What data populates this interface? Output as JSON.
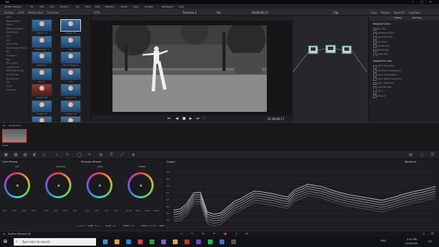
{
  "window": {
    "title": "Sol"
  },
  "menu": [
    "DaVinci Resolve",
    "File",
    "Edit",
    "Trim",
    "Timeline",
    "Clip",
    "Mark",
    "View",
    "Playback",
    "Fusion",
    "Color",
    "Fairlight",
    "Workspace",
    "Help"
  ],
  "toolbar": {
    "left": [
      "Gallery",
      "LUTs",
      "Media Pool",
      "Timeline"
    ],
    "zoom": "47%",
    "timeline_name": "Timeline 1",
    "project": "Sol",
    "timecode": "00:00:00:17",
    "clip_label": "Clip",
    "right": [
      "Clips",
      "Nodes",
      "OpenFX",
      "Lightbox"
    ]
  },
  "albums": [
    "Stills",
    "PowerGrade",
    "Stills 2",
    "MemoryUsage 1",
    "ShotMatch",
    "MC",
    "LUT",
    "Sony SLog",
    "Blackmagic Design",
    "DJI",
    "Panasonic",
    "Red",
    "Film Looks",
    "LinearInvert",
    "HDR Hybrid Log",
    "VSO/RC Rec",
    "Technicolor",
    "Fuji",
    "ACES",
    "Favorites"
  ],
  "stills": [
    {
      "a": "Custom 11",
      "b": "Custom 12",
      "ar": false,
      "br": false
    },
    {
      "a": "Blackmagic 7",
      "b": "Clip",
      "ar": false,
      "br": false
    },
    {
      "a": "Aged Film",
      "b": "Bleach Bypass",
      "ar": false,
      "br": false
    },
    {
      "a": "Blue 2",
      "b": "Cool",
      "ar": false,
      "br": false
    },
    {
      "a": "Clayton 18",
      "b": "Custom 11",
      "ar": true,
      "br": false
    },
    {
      "a": "Custom 21",
      "b": "Custom 15",
      "ar": false,
      "br": false
    },
    {
      "a": "Digital 1",
      "b": "Custom 20",
      "ar": false,
      "br": false
    },
    {
      "a": "Custom 11",
      "b": "Custom 2",
      "ar": false,
      "br": false
    }
  ],
  "viewer": {
    "timecode_out": "01:00:00:17"
  },
  "library": {
    "tabs": [
      "Library",
      "Settings"
    ],
    "section1": "ResolveFX Blur",
    "blur": [
      "Box Blur",
      "Directional Blur",
      "Gaussian Blur",
      "Lens Blur",
      "Mosaic Blur",
      "Radial Blur",
      "Zoom Blur"
    ],
    "section2": "ResolveFX Color",
    "color": [
      "ACES Transform",
      "Chromatic Adaptation",
      "Color Compressor",
      "Color Space Transform",
      "Color Stabilizer",
      "Contrast Pop",
      "DCTL",
      "Dehaze"
    ]
  },
  "clip": {
    "number": "01",
    "timecode": "00:00:00:17",
    "codec": "H.264"
  },
  "wheels": {
    "title": "Color Wheels",
    "mode": "Primaries Wheels",
    "items": [
      {
        "name": "Lift",
        "values": [
          "0.00",
          "0.00",
          "0.00",
          "0.00"
        ]
      },
      {
        "name": "Gamma",
        "values": [
          "0.00",
          "0.00",
          "0.00",
          "0.00"
        ]
      },
      {
        "name": "Gain",
        "values": [
          "1.00",
          "1.00",
          "1.00",
          "1.00"
        ]
      },
      {
        "name": "Offset",
        "values": [
          "25.00",
          "25.00",
          "25.00",
          "25.00"
        ]
      }
    ],
    "footer": [
      {
        "label": "Contrast",
        "value": "1.000"
      },
      {
        "label": "Pivot",
        "value": "0.435"
      },
      {
        "label": "Sat",
        "value": "50.00"
      },
      {
        "label": "Hue",
        "value": "50.00"
      },
      {
        "label": "Lum Mix",
        "value": "100.00"
      }
    ]
  },
  "scopes": {
    "title": "Scopes",
    "mode": "Waveform",
    "scale": [
      "1023",
      "896",
      "768",
      "640",
      "512",
      "384",
      "256",
      "128",
      "0"
    ],
    "trace": [
      0.25,
      0.27,
      0.37,
      0.55,
      0.56,
      0.22,
      0.18,
      0.2,
      0.3,
      0.4,
      0.45,
      0.52,
      0.58,
      0.57,
      0.55,
      0.53,
      0.5,
      0.48,
      0.6,
      0.65,
      0.7,
      0.68,
      0.66,
      0.62,
      0.58,
      0.55,
      0.52,
      0.5,
      0.48,
      0.46,
      0.44,
      0.42,
      0.45,
      0.48,
      0.52,
      0.55,
      0.58,
      0.6,
      0.63,
      0.66
    ]
  },
  "app_name": "DaVinci Resolve 16",
  "taskbar": {
    "search": "Type here to search",
    "time": "2:57 PM",
    "date": "12/5/2019",
    "lang": "ENG"
  },
  "colors": {
    "accent": "#c8312f",
    "panel": "#1e1e22",
    "bg": "#1c1c20"
  }
}
